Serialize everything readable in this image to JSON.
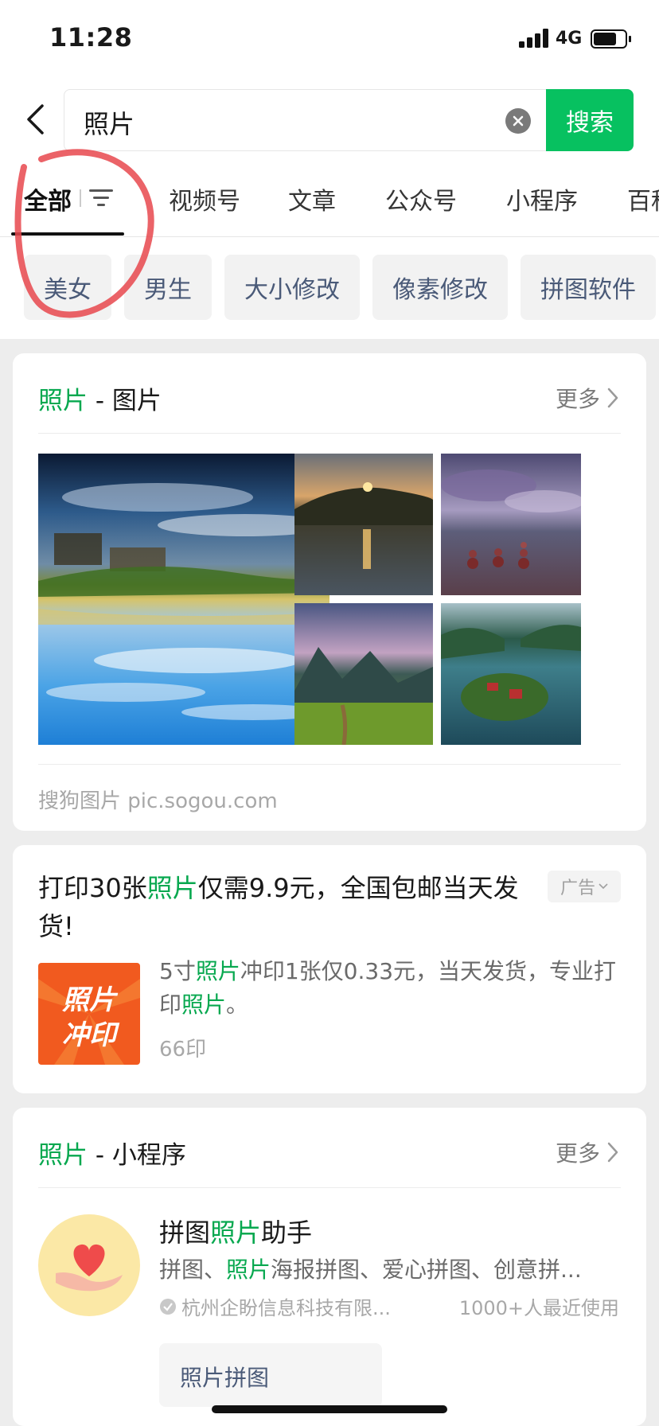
{
  "status": {
    "time": "11:28",
    "network": "4G",
    "battery_level": 0.75
  },
  "search": {
    "query": "照片",
    "button_label": "搜索"
  },
  "tabs": [
    {
      "label": "全部",
      "active": true
    },
    {
      "label": "视频号"
    },
    {
      "label": "文章"
    },
    {
      "label": "公众号"
    },
    {
      "label": "小程序"
    },
    {
      "label": "百科"
    }
  ],
  "chips": [
    "美女",
    "男生",
    "大小修改",
    "像素修改",
    "拼图软件"
  ],
  "image_card": {
    "keyword": "照片",
    "suffix": " - 图片",
    "more": "更多",
    "source": "搜狗图片 pic.sogou.com"
  },
  "ad_card": {
    "title_pre": "打印30张",
    "title_kw": "照片",
    "title_post": "仅需9.9元，全国包邮当天发货!",
    "badge": "广告",
    "logo_line1": "照片",
    "logo_line2": "冲印",
    "desc_pre": "5寸",
    "desc_kw": "照片",
    "desc_mid": "冲印1张仅0.33元，当天发货，专业打印",
    "desc_kw2": "照片",
    "desc_end": "。",
    "brand": "66印"
  },
  "mp_card": {
    "keyword": "照片",
    "suffix": " - 小程序",
    "more": "更多",
    "name_pre": "拼图",
    "name_kw": "照片",
    "name_post": "助手",
    "desc_pre": "拼图、",
    "desc_kw": "照片",
    "desc_post": "海报拼图、爱心拼图、创意拼...",
    "org": "杭州企盼信息科技有限...",
    "users": "1000+人最近使用",
    "service": "照片拼图"
  },
  "colors": {
    "accent": "#07c160",
    "keyword": "#07a84f",
    "annotation": "#e8484e"
  }
}
